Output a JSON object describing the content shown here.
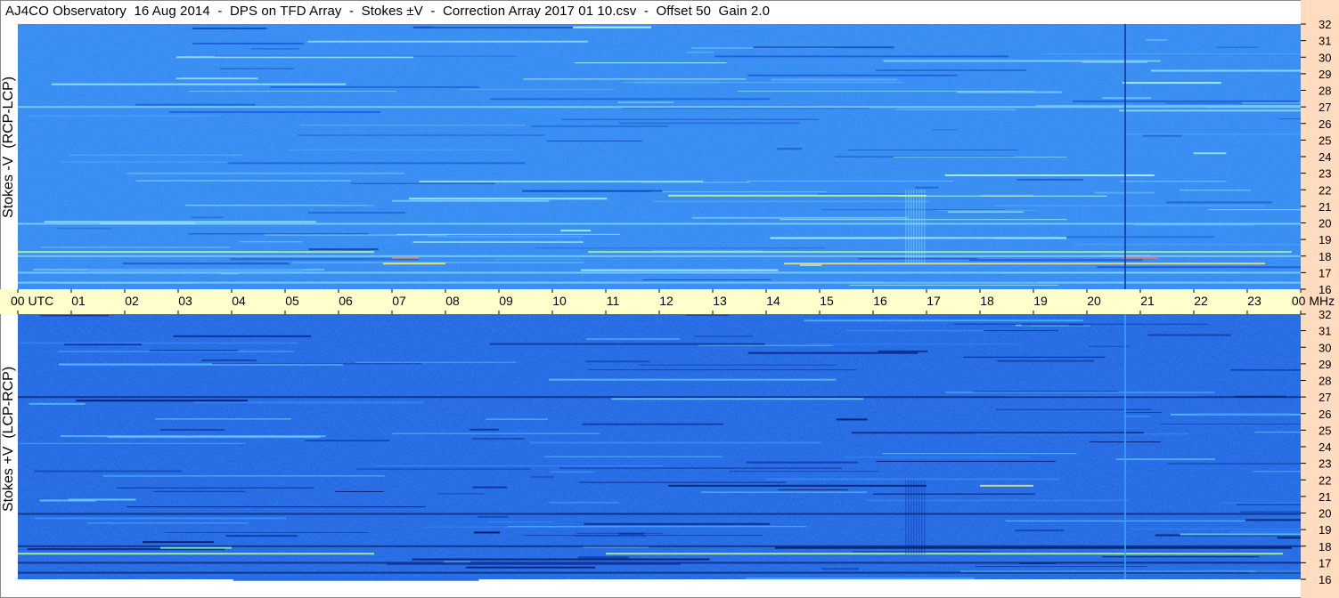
{
  "title": "AJ4CO Observatory  16 Aug 2014  -  DPS on TFD Array  -  Stokes ±V  -  Correction Array 2017 01 10.csv  -  Offset 50  Gain 2.0",
  "colors": {
    "strip": "#ffffcc",
    "right_axis_bg": "#ffdcc0",
    "top_panel_base": "#2f86f0",
    "bottom_panel_base": "#1a5fe0"
  },
  "chart_data": [
    {
      "type": "heatmap",
      "panel": "top",
      "ylabel": "Stokes -V  (RCP-LCP)",
      "ylim": [
        16,
        32
      ],
      "y_ticks": [
        "32",
        "31",
        "30",
        "29",
        "28",
        "27",
        "26",
        "25",
        "24",
        "23",
        "22",
        "21",
        "20",
        "19",
        "18",
        "17",
        "16"
      ],
      "x_range_hours": [
        0,
        24
      ]
    },
    {
      "type": "heatmap",
      "panel": "bottom",
      "ylabel": "Stokes +V  (LCP-RCP)",
      "ylim": [
        16,
        32
      ],
      "y_ticks": [
        "32",
        "31",
        "30",
        "29",
        "28",
        "27",
        "26",
        "25",
        "24",
        "23",
        "22",
        "21",
        "20",
        "19",
        "18",
        "17",
        "16"
      ],
      "x_range_hours": [
        0,
        24
      ]
    }
  ],
  "time_axis": {
    "ticks": [
      "00",
      "01",
      "02",
      "03",
      "04",
      "05",
      "06",
      "07",
      "08",
      "09",
      "10",
      "11",
      "12",
      "13",
      "14",
      "15",
      "16",
      "17",
      "18",
      "19",
      "20",
      "21",
      "22",
      "23",
      "00"
    ],
    "first_suffix": "UTC",
    "last_suffix": "MHz"
  }
}
